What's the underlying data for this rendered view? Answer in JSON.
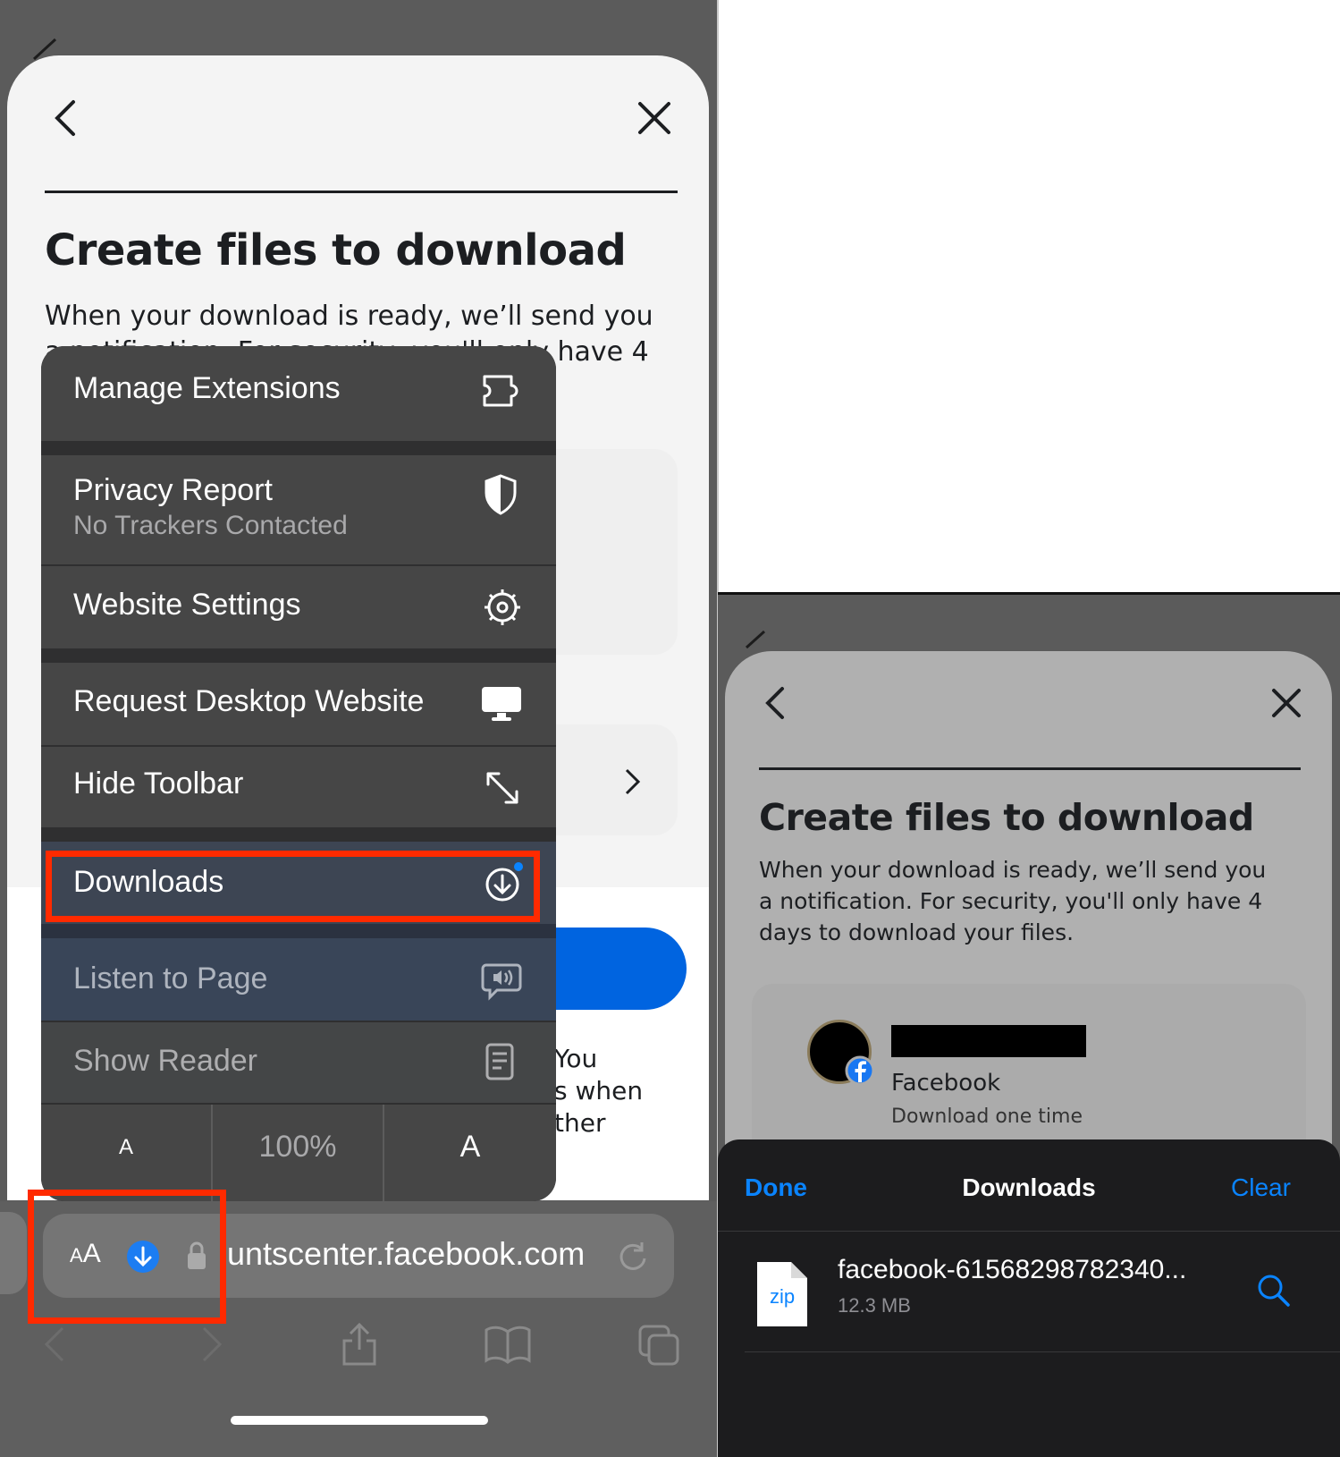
{
  "left": {
    "page_title": "Create files to download",
    "page_desc_line1": "When your download is ready, we’ll send you",
    "page_desc_line2": "a notification. For security, you'll only have 4",
    "partial_text_1": "You",
    "partial_text_2": "s when",
    "partial_text_3": "ther",
    "menu": {
      "manage_extensions": "Manage Extensions",
      "privacy_report": "Privacy Report",
      "privacy_sub": "No Trackers Contacted",
      "website_settings": "Website Settings",
      "request_desktop": "Request Desktop Website",
      "hide_toolbar": "Hide Toolbar",
      "downloads": "Downloads",
      "listen_to_page": "Listen to Page",
      "show_reader": "Show Reader",
      "font_small": "A",
      "zoom": "100%",
      "font_large": "A"
    },
    "url_bar": {
      "aa": "AA",
      "url": "untscenter.facebook.com"
    },
    "highlight_color": "#ff2a00"
  },
  "right": {
    "page_title": "Create files to download",
    "page_desc_line1": "When your download is ready, we’ll send you",
    "page_desc_line2": "a notification. For security, you'll only have 4",
    "page_desc_line3": "days to download your files.",
    "account_service": "Facebook",
    "account_sub": "Download one time",
    "downloads_sheet": {
      "done": "Done",
      "title": "Downloads",
      "clear": "Clear",
      "file_name": "facebook-61568298782340...",
      "file_size": "12.3 MB",
      "file_type": "zip"
    }
  }
}
